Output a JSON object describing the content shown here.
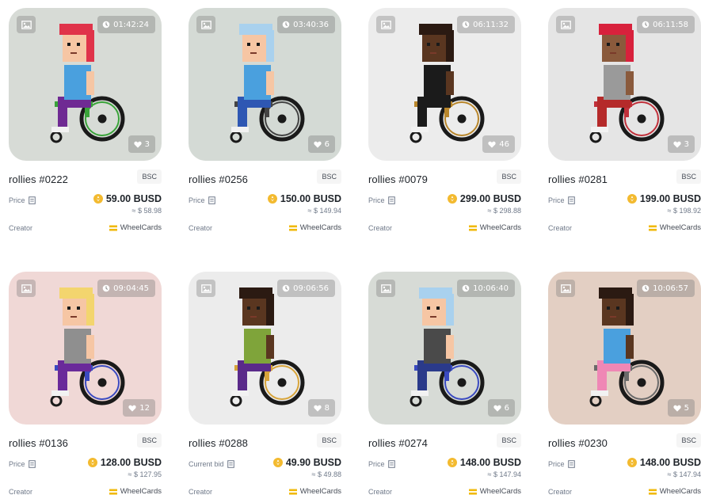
{
  "labels": {
    "price": "Price",
    "current_bid": "Current bid",
    "creator": "Creator"
  },
  "cards": [
    {
      "title": "rollies #0222",
      "chain": "BSC",
      "timer": "01:42:24",
      "likes": "3",
      "price_label": "Price",
      "price": "59.00 BUSD",
      "usd": "≈ $ 58.98",
      "creator": "WheelCards",
      "bg": "#d7dbd6",
      "hair": "#e0334a",
      "skin": "#f6c6a4",
      "shirt": "#4aa0de",
      "pants": "#6f2a93",
      "chair": "#3aa33a"
    },
    {
      "title": "rollies #0256",
      "chain": "BSC",
      "timer": "03:40:36",
      "likes": "6",
      "price_label": "Price",
      "price": "150.00 BUSD",
      "usd": "≈ $ 149.94",
      "creator": "WheelCards",
      "bg": "#d4dad5",
      "hair": "#a9d1ee",
      "skin": "#f6c6a4",
      "shirt": "#4aa0de",
      "pants": "#2e57b3",
      "chair": "#444444"
    },
    {
      "title": "rollies #0079",
      "chain": "BSC",
      "timer": "06:11:32",
      "likes": "46",
      "price_label": "Price",
      "price": "299.00 BUSD",
      "usd": "≈ $ 298.88",
      "creator": "WheelCards",
      "bg": "#ececec",
      "hair": "#2b1a12",
      "skin": "#5a3620",
      "shirt": "#1b1b1b",
      "pants": "#1b1b1b",
      "chair": "#b8862b"
    },
    {
      "title": "rollies #0281",
      "chain": "BSC",
      "timer": "06:11:58",
      "likes": "3",
      "price_label": "Price",
      "price": "199.00 BUSD",
      "usd": "≈ $ 198.92",
      "creator": "WheelCards",
      "bg": "#e5e5e5",
      "hair": "#d8213c",
      "skin": "#8a5a3c",
      "shirt": "#9a9a9a",
      "pants": "#b52a2a",
      "chair": "#c0303a"
    },
    {
      "title": "rollies #0136",
      "chain": "BSC",
      "timer": "09:04:45",
      "likes": "12",
      "price_label": "Price",
      "price": "128.00 BUSD",
      "usd": "≈ $ 127.95",
      "creator": "WheelCards",
      "bg": "#f0d8d6",
      "hair": "#f3d56e",
      "skin": "#f6c6a4",
      "shirt": "#8f8f8f",
      "pants": "#6a2a9a",
      "chair": "#3a4ac0"
    },
    {
      "title": "rollies #0288",
      "chain": "BSC",
      "timer": "09:06:56",
      "likes": "8",
      "price_label": "Current bid",
      "price": "49.90 BUSD",
      "usd": "≈ $ 49.88",
      "creator": "WheelCards",
      "bg": "#ececec",
      "hair": "#2b1a12",
      "skin": "#5a3620",
      "shirt": "#7fa43a",
      "pants": "#5a2a8a",
      "chair": "#d7a43a"
    },
    {
      "title": "rollies #0274",
      "chain": "BSC",
      "timer": "10:06:40",
      "likes": "6",
      "price_label": "Price",
      "price": "148.00 BUSD",
      "usd": "≈ $ 147.94",
      "creator": "WheelCards",
      "bg": "#d7dbd6",
      "hair": "#a9d1ee",
      "skin": "#f6c6a4",
      "shirt": "#4a4a4a",
      "pants": "#2a3a8a",
      "chair": "#3a4ac0"
    },
    {
      "title": "rollies #0230",
      "chain": "BSC",
      "timer": "10:06:57",
      "likes": "5",
      "price_label": "Price",
      "price": "148.00 BUSD",
      "usd": "≈ $ 147.94",
      "creator": "WheelCards",
      "bg": "#e3cfc3",
      "hair": "#2b1a12",
      "skin": "#5a3620",
      "shirt": "#4aa0de",
      "pants": "#ef87b5",
      "chair": "#6a6a6a"
    }
  ]
}
